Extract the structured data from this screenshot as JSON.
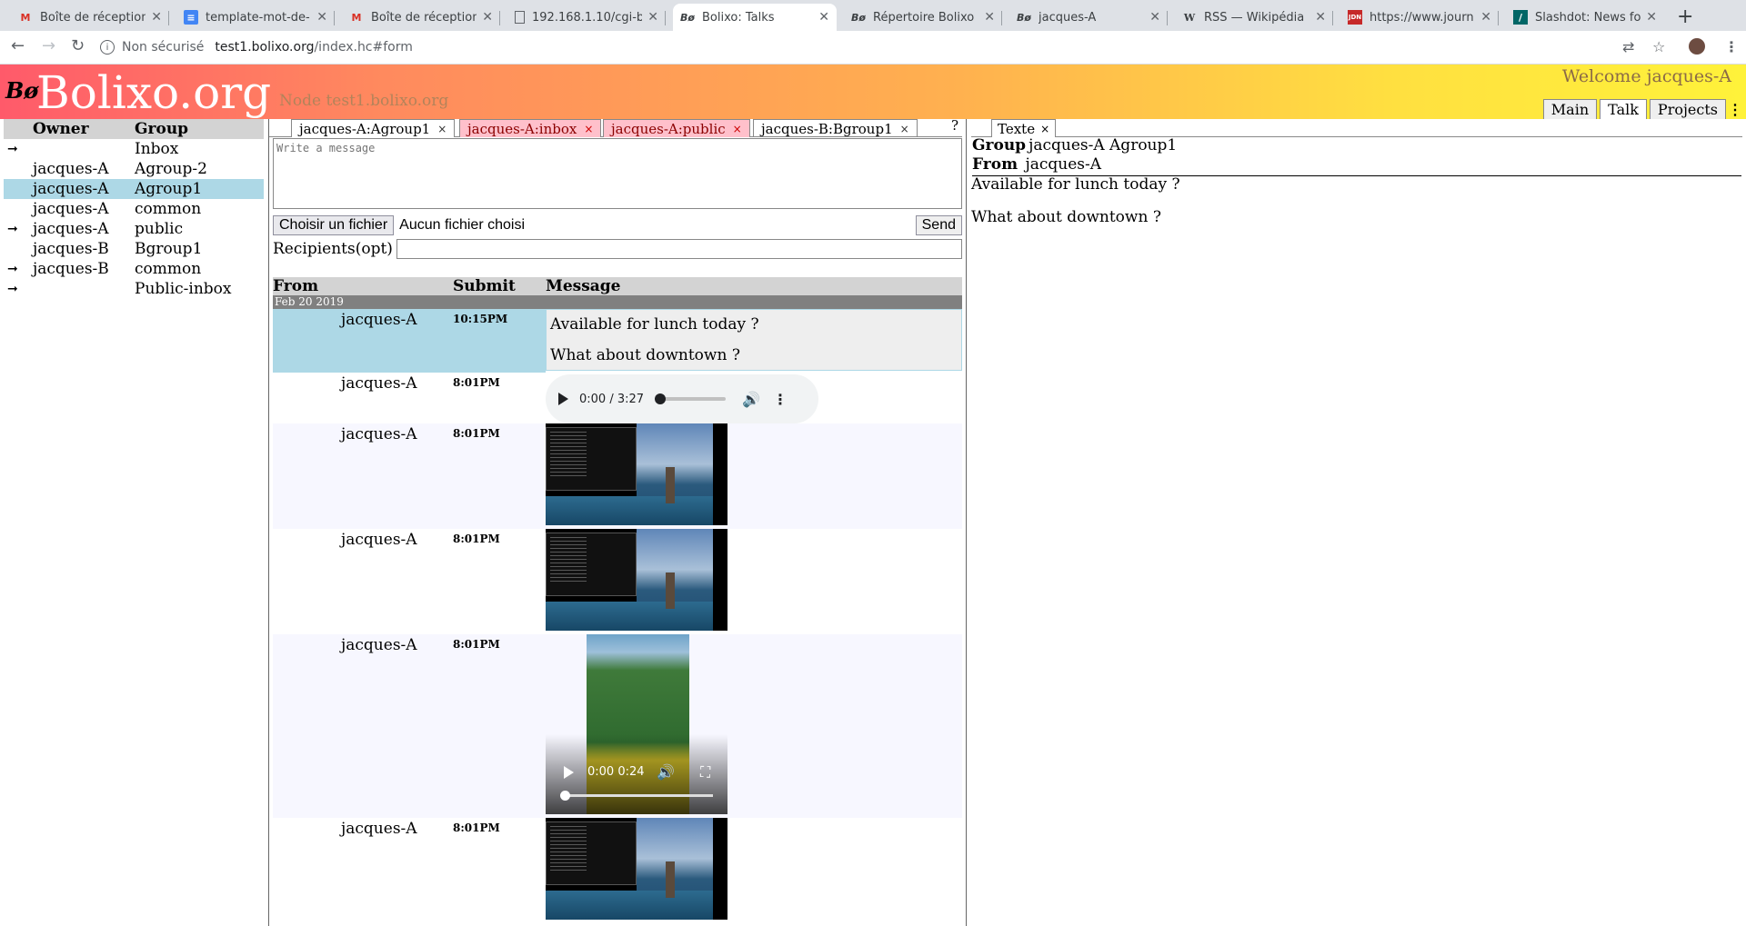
{
  "browser": {
    "tabs": [
      {
        "title": "Boîte de réception",
        "icon": "gmail-icon"
      },
      {
        "title": "template-mot-de-",
        "icon": "docs-icon"
      },
      {
        "title": "Boîte de réception",
        "icon": "gmail-icon"
      },
      {
        "title": "192.168.1.10/cgi-b",
        "icon": "page-icon"
      },
      {
        "title": "Bolixo: Talks",
        "icon": "bolixo-icon"
      },
      {
        "title": "Répertoire Bolixo",
        "icon": "bolixo-icon"
      },
      {
        "title": "jacques-A",
        "icon": "bolixo-icon"
      },
      {
        "title": "RSS — Wikipédia",
        "icon": "wikipedia-icon"
      },
      {
        "title": "https://www.journ",
        "icon": "jdn-icon"
      },
      {
        "title": "Slashdot: News fo",
        "icon": "slashdot-icon"
      }
    ],
    "address": {
      "security": "Non sécurisé",
      "host": "test1.bolixo.org",
      "path": "/index.hc#form"
    }
  },
  "header": {
    "logo_glyph": "Bø",
    "logo_text": "Bolixo.org",
    "node": "Node test1.bolixo.org",
    "welcome": "Welcome jacques-A",
    "tabs": [
      "Main",
      "Talk",
      "Projects"
    ],
    "active_tab": "Talk",
    "menu_glyph": "⋮"
  },
  "groups": {
    "headers": {
      "owner": "Owner",
      "group": "Group"
    },
    "rows": [
      {
        "arrow": "➞",
        "owner": "",
        "group": "Inbox",
        "selected": false
      },
      {
        "arrow": "",
        "owner": "jacques-A",
        "group": "Agroup-2",
        "selected": false
      },
      {
        "arrow": "",
        "owner": "jacques-A",
        "group": "Agroup1",
        "selected": true
      },
      {
        "arrow": "",
        "owner": "jacques-A",
        "group": "common",
        "selected": false
      },
      {
        "arrow": "➞",
        "owner": "jacques-A",
        "group": "public",
        "selected": false
      },
      {
        "arrow": "",
        "owner": "jacques-B",
        "group": "Bgroup1",
        "selected": false
      },
      {
        "arrow": "➞",
        "owner": "jacques-B",
        "group": "common",
        "selected": false
      },
      {
        "arrow": "➞",
        "owner": "",
        "group": "Public-inbox",
        "selected": false
      }
    ]
  },
  "talk": {
    "tabs": [
      {
        "label": "jacques-A:Agroup1",
        "style": "active"
      },
      {
        "label": "jacques-A:inbox",
        "style": "pink"
      },
      {
        "label": "jacques-A:public",
        "style": "pink"
      },
      {
        "label": "jacques-B:Bgroup1",
        "style": "normal"
      }
    ],
    "tab_close": "×",
    "help": "?",
    "compose": {
      "placeholder": "Write a message",
      "file_button": "Choisir un fichier",
      "file_name": "Aucun fichier choisi",
      "send": "Send",
      "recipients_label": "Recipients(opt)"
    },
    "table": {
      "headers": {
        "from": "From",
        "submit": "Submit",
        "message": "Message"
      },
      "date": "Feb 20 2019",
      "messages": [
        {
          "from": "jacques-A",
          "time": "10:15PM",
          "kind": "text",
          "lines": [
            "Available for lunch today ?",
            "What about downtown ?"
          ]
        },
        {
          "from": "jacques-A",
          "time": "8:01PM",
          "kind": "audio",
          "duration": "0:00 / 3:27"
        },
        {
          "from": "jacques-A",
          "time": "8:01PM",
          "kind": "image"
        },
        {
          "from": "jacques-A",
          "time": "8:01PM",
          "kind": "image"
        },
        {
          "from": "jacques-A",
          "time": "8:01PM",
          "kind": "video",
          "time_display": "0:00 0:24"
        },
        {
          "from": "jacques-A",
          "time": "8:01PM",
          "kind": "image"
        }
      ]
    }
  },
  "viewer": {
    "tab": "Texte",
    "tab_close": "×",
    "group_label": "Group",
    "group_value": "jacques-A Agroup1",
    "from_label": "From",
    "from_value": "jacques-A",
    "lines": [
      "Available for lunch today ?",
      "What about downtown ?"
    ]
  }
}
